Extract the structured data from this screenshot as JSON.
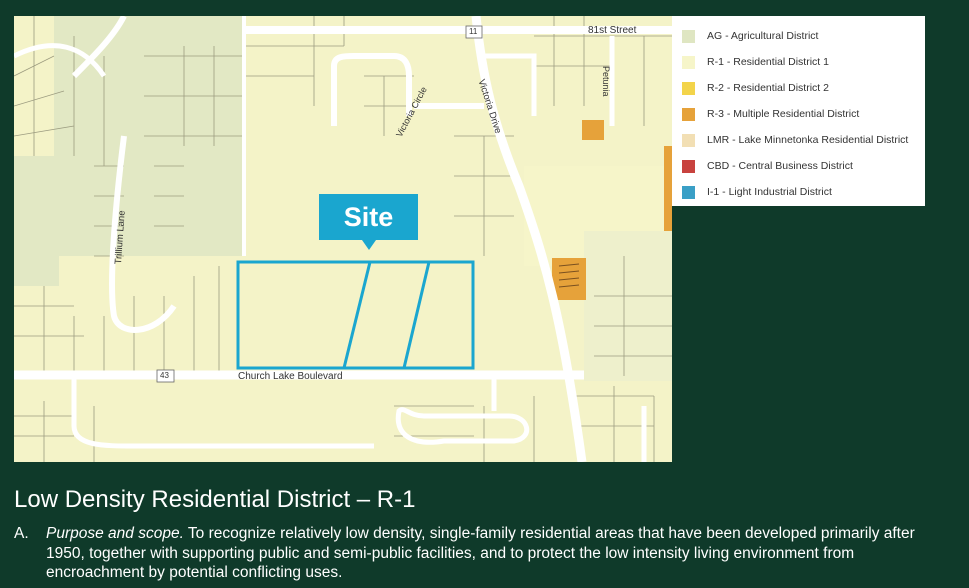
{
  "map": {
    "street_labels": {
      "street_81st": "81st Street",
      "petunia": "Petunia",
      "victoria_circle": "Victoria Circle",
      "victoria_drive": "Victoria Drive",
      "trillium_lane": "Trillium Lane",
      "church_lake_blvd": "Church Lake Boulevard",
      "route_11": "11",
      "route_43": "43"
    },
    "site_label": "Site",
    "site_outline_color": "#1aa6cf"
  },
  "legend": {
    "items": [
      {
        "label": "AG - Agricultural District",
        "color": "#dfe6c2"
      },
      {
        "label": "R-1 - Residential District 1",
        "color": "#f6f5c9"
      },
      {
        "label": "R-2 - Residential District 2",
        "color": "#f3d44a"
      },
      {
        "label": "R-3 - Multiple Residential District",
        "color": "#e6a23a"
      },
      {
        "label": "LMR - Lake Minnetonka Residential District",
        "color": "#f2dfb4"
      },
      {
        "label": "CBD - Central Business District",
        "color": "#c8423e"
      },
      {
        "label": "I-1 - Light Industrial District",
        "color": "#3a9fc6"
      }
    ]
  },
  "section": {
    "heading": "Low Density Residential District – R-1",
    "item_marker": "A.",
    "purpose_title": "Purpose and scope.",
    "purpose_text": " To recognize relatively low density, single-family residential areas that have been developed primarily after 1950, together with supporting public and semi-public facilities, and to protect the low intensity living environment from encroachment by potential conflicting uses."
  },
  "colors": {
    "background": "#0f3a2a",
    "map_base": "#f4f3c8",
    "park_green": "#e2e8c4",
    "road": "#ffffff",
    "parcel_line": "#9c9c80"
  }
}
